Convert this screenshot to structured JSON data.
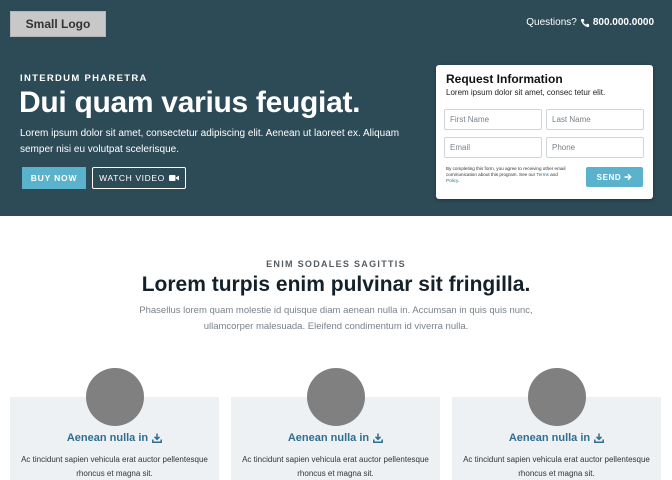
{
  "header": {
    "logo": "Small Logo",
    "questions_label": "Questions?",
    "phone": "800.000.0000"
  },
  "hero": {
    "eyebrow": "INTERDUM PHARETRA",
    "title": "Dui quam varius feugiat.",
    "text": "Lorem ipsum dolor sit amet, consectetur adipiscing elit. Aenean ut laoreet ex. Aliquam semper nisi eu volutpat scelerisque.",
    "buy_label": "BUY NOW",
    "watch_label": "WATCH VIDEO"
  },
  "form": {
    "title": "Request Information",
    "subtitle": "Lorem ipsum dolor sit amet, consec tetur elit.",
    "first_name_placeholder": "First Name",
    "last_name_placeholder": "Last Name",
    "email_placeholder": "Email",
    "phone_placeholder": "Phone",
    "legal_text": "By completing this form, you agree to receiving other email communication about this program. See our",
    "terms_label": "Terms",
    "and_label": "and",
    "policy_label": "Policy.",
    "send_label": "SEND"
  },
  "section": {
    "eyebrow": "ENIM SODALES SAGITTIS",
    "title": "Lorem turpis enim pulvinar sit fringilla.",
    "text": "Phasellus lorem quam molestie id quisque diam aenean nulla in. Accumsan in quis quis nunc, ullamcorper malesuada. Eleifend condimentum id viverra nulla."
  },
  "features": [
    {
      "title": "Aenean nulla in",
      "text": "Ac tincidunt sapien vehicula erat auctor pellentesque rhoncus et magna sit."
    },
    {
      "title": "Aenean nulla in",
      "text": "Ac tincidunt sapien vehicula erat auctor pellentesque rhoncus et magna sit."
    },
    {
      "title": "Aenean nulla in",
      "text": "Ac tincidunt sapien vehicula erat auctor pellentesque rhoncus et magna sit."
    }
  ],
  "colors": {
    "hero_bg": "#2d4a57",
    "accent": "#5bb2cc",
    "link": "#2f6e8f",
    "placeholder_image": "#808080"
  }
}
